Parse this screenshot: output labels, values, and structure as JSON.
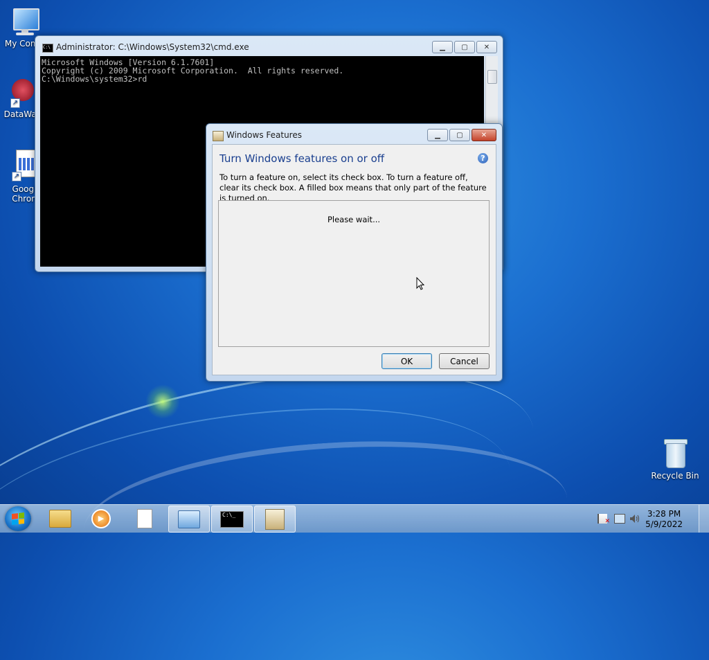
{
  "desktop": {
    "icons": [
      {
        "label": "My Comp"
      },
      {
        "label": "DataWag"
      },
      {
        "label1": "Googl",
        "label2": "Chron"
      },
      {
        "label": "Recycle Bin"
      }
    ]
  },
  "cmd": {
    "title": "Administrator: C:\\Windows\\System32\\cmd.exe",
    "lines": [
      "Microsoft Windows [Version 6.1.7601]",
      "Copyright (c) 2009 Microsoft Corporation.  All rights reserved.",
      "",
      "C:\\Windows\\system32>rd"
    ]
  },
  "features_dialog": {
    "title": "Windows Features",
    "heading": "Turn Windows features on or off",
    "description": "To turn a feature on, select its check box. To turn a feature off, clear its check box. A filled box means that only part of the feature is turned on.",
    "status": "Please wait...",
    "ok_label": "OK",
    "cancel_label": "Cancel",
    "help_symbol": "?"
  },
  "window_buttons": {
    "minimize": "▁",
    "maximize": "▢",
    "close": "✕"
  },
  "taskbar": {
    "items": [
      "start-button",
      "windows-explorer",
      "media-player",
      "notepad",
      "control-panel",
      "command-prompt",
      "windows-features"
    ],
    "active_items": [
      "control-panel",
      "command-prompt",
      "windows-features"
    ],
    "time": "3:28 PM",
    "date": "5/9/2022"
  }
}
